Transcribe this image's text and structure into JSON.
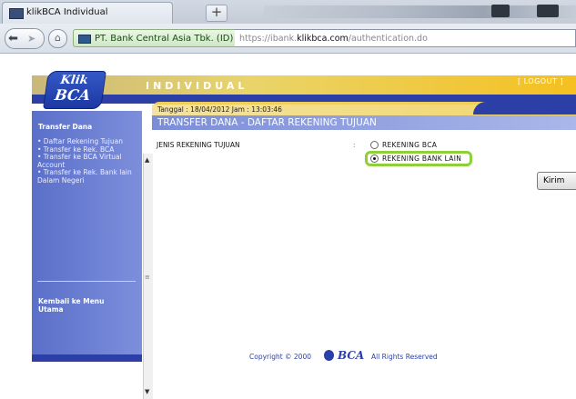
{
  "browser": {
    "tab_title": "klikBCA Individual",
    "new_tab_label": "+",
    "identity_label": "PT. Bank Central Asia Tbk. (ID)",
    "url_prefix": "https://ibank.",
    "url_domain": "klikbca.com",
    "url_path": "/authentication.do"
  },
  "header": {
    "logo_line1": "Klik",
    "logo_line2": "BCA",
    "title": "INDIVIDUAL",
    "logout": "[ LOGOUT ]"
  },
  "sidebar": {
    "heading": "Transfer Dana",
    "items": [
      "• Daftar Rekening Tujuan",
      "• Transfer ke Rek. BCA",
      "• Transfer ke BCA Virtual Account",
      "• Transfer ke Rek. Bank lain Dalam Negeri"
    ],
    "back_link": "Kembali ke Menu Utama"
  },
  "main": {
    "date_text": "Tanggal : 18/04/2012 Jam : 13:03:46",
    "title": "TRANSFER DANA - DAFTAR REKENING TUJUAN",
    "field_label": "JENIS REKENING TUJUAN",
    "separator": ":",
    "options": [
      "REKENING BCA",
      "REKENING BANK LAIN"
    ],
    "selected_option": "REKENING BANK LAIN",
    "submit_label": "Kirim"
  },
  "footer": {
    "copyright": "Copyright © 2000",
    "brand": "BCA",
    "rights": "All Rights Reserved"
  },
  "colors": {
    "brand_blue": "#2b3fa6",
    "sidebar_blue": "#6a7fd2",
    "header_gold": "#f5c020",
    "highlight_green": "#8fcf3a"
  }
}
